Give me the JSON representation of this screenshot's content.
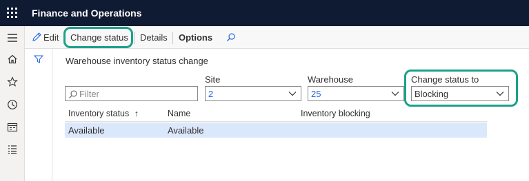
{
  "app": {
    "title": "Finance and Operations"
  },
  "actions": {
    "edit": "Edit",
    "change_status": "Change status",
    "details": "Details",
    "options": "Options"
  },
  "page": {
    "title": "Warehouse inventory status change"
  },
  "filter": {
    "placeholder": "Filter"
  },
  "fields": {
    "site": {
      "label": "Site",
      "value": "2"
    },
    "warehouse": {
      "label": "Warehouse",
      "value": "25"
    },
    "change_status_to": {
      "label": "Change status to",
      "value": "Blocking"
    }
  },
  "grid": {
    "columns": [
      "Inventory status",
      "Name",
      "Inventory blocking"
    ],
    "sort_indicator": "↑",
    "rows": [
      {
        "inventory_status": "Available",
        "name": "Available",
        "inventory_blocking": ""
      }
    ]
  },
  "colors": {
    "topbar": "#0f1b33",
    "highlight": "#1ba08a",
    "selected_row": "#dbe8fb",
    "link_value": "#2266e3"
  }
}
